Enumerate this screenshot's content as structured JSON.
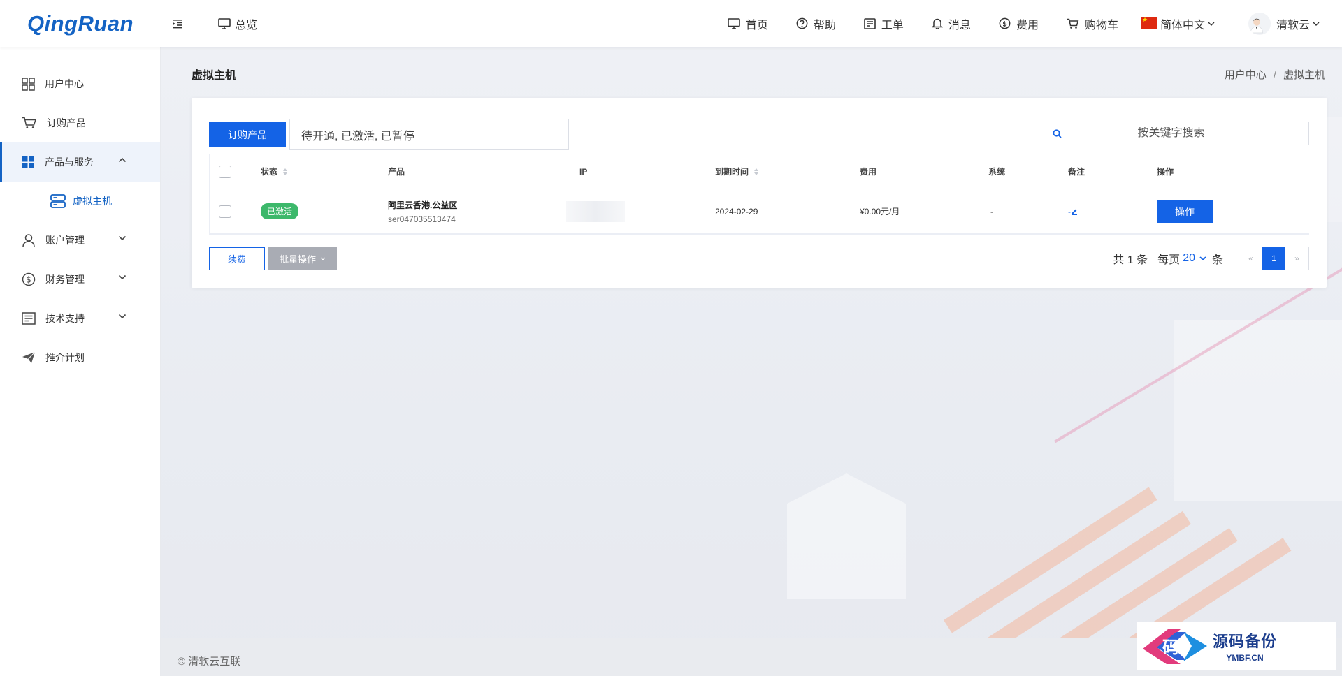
{
  "header": {
    "logo": "QingRuan",
    "overview": "总览",
    "nav": [
      {
        "label": "首页",
        "icon": "monitor-icon"
      },
      {
        "label": "帮助",
        "icon": "help-icon"
      },
      {
        "label": "工单",
        "icon": "ticket-icon"
      },
      {
        "label": "消息",
        "icon": "bell-icon"
      },
      {
        "label": "费用",
        "icon": "dollar-icon"
      },
      {
        "label": "购物车",
        "icon": "cart-icon"
      }
    ],
    "language": "简体中文",
    "user": "清软云"
  },
  "sidebar": {
    "items": [
      {
        "label": "用户中心",
        "icon": "grid-icon"
      },
      {
        "label": "订购产品",
        "icon": "cart-icon"
      },
      {
        "label": "产品与服务",
        "icon": "apps-icon"
      },
      {
        "label": "账户管理",
        "icon": "user-icon"
      },
      {
        "label": "财务管理",
        "icon": "dollar-icon"
      },
      {
        "label": "技术支持",
        "icon": "doc-icon"
      },
      {
        "label": "推介计划",
        "icon": "send-icon"
      }
    ],
    "sub_item": "虚拟主机"
  },
  "page": {
    "title": "虚拟主机",
    "breadcrumb": [
      "用户中心",
      "虚拟主机"
    ]
  },
  "toolbar": {
    "order_button": "订购产品",
    "status_filter": "待开通, 已激活, 已暂停",
    "search_placeholder": "按关键字搜索"
  },
  "table": {
    "columns": [
      "状态",
      "产品",
      "IP",
      "到期时间",
      "费用",
      "系统",
      "备注",
      "操作"
    ],
    "rows": [
      {
        "status": "已激活",
        "product_name": "阿里云香港.公益区",
        "product_id": "ser047035513474",
        "ip": "",
        "expire": "2024-02-29",
        "fee": "¥0.00元/月",
        "os": "-",
        "note": "-",
        "action": "操作"
      }
    ]
  },
  "footer_actions": {
    "renew": "续费",
    "batch": "批量操作"
  },
  "pagination": {
    "total": "共 1 条",
    "per_page_label": "每页",
    "per_page": "20",
    "unit": "条",
    "prev": "«",
    "current": "1",
    "next": "»"
  },
  "copyright": "© 清软云互联",
  "watermark": {
    "cn": "源码备份",
    "en": "YMBF.CN",
    "mark": "码"
  },
  "colors": {
    "primary": "#1463e6",
    "logo": "#1463c4",
    "active_badge": "#3db86b",
    "gray_button": "#a9acb4"
  }
}
